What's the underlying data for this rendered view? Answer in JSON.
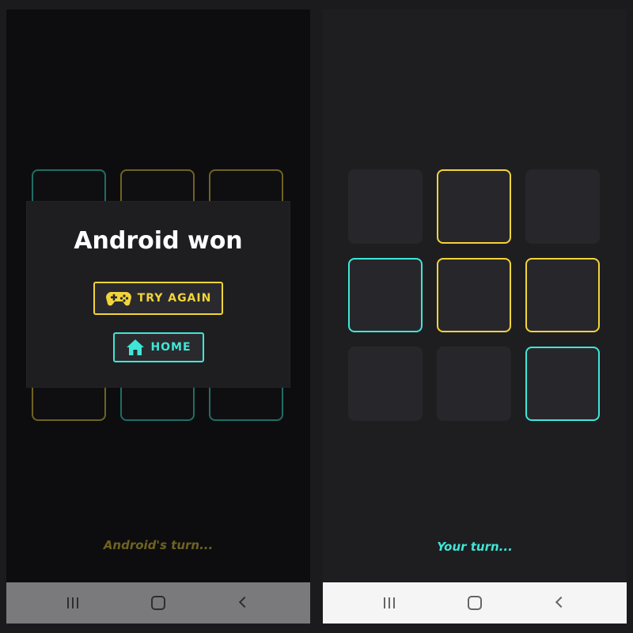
{
  "left_screen": {
    "board": [
      "O",
      "X",
      "X",
      "",
      "",
      "",
      "X",
      "O",
      "O"
    ],
    "dialog": {
      "title": "Android won",
      "try_again_label": "TRY AGAIN",
      "home_label": "HOME"
    },
    "turn_text": "Android's turn..."
  },
  "right_screen": {
    "board": [
      "",
      "X",
      "",
      "O",
      "X",
      "X",
      "",
      "",
      "O"
    ],
    "turn_text": "Your turn..."
  },
  "nav": {
    "recents_icon": "recents-icon",
    "home_icon": "home-icon",
    "back_icon": "back-icon"
  },
  "colors": {
    "x_mark": "#f2d43a",
    "o_mark": "#3fe6d6",
    "x_dim": "#6f6320",
    "o_dim": "#1f6e66",
    "left_background": "#0d0d0f",
    "right_background": "#1e1e21"
  }
}
